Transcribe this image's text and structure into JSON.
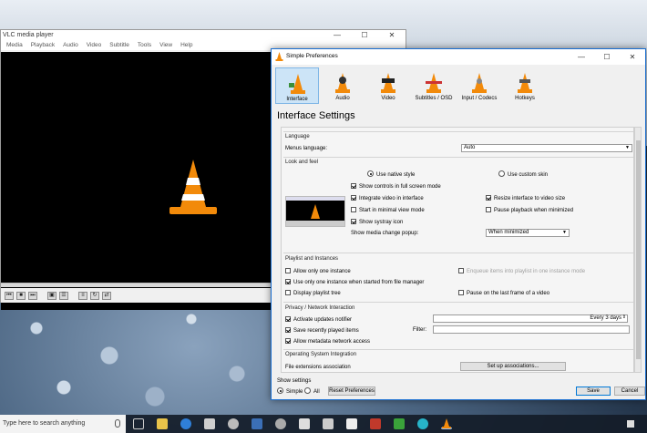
{
  "vlc": {
    "title": "VLC media player",
    "menu": [
      "Media",
      "Playback",
      "Audio",
      "Video",
      "Subtitle",
      "Tools",
      "View",
      "Help"
    ],
    "controls": [
      "previous-icon",
      "stop-icon",
      "next-icon",
      "fullscreen-icon",
      "extended-settings-icon",
      "playlist-icon",
      "loop-icon",
      "shuffle-icon"
    ]
  },
  "prefs": {
    "title": "Simple Preferences",
    "heading": "Interface Settings",
    "categories": [
      "Interface",
      "Audio",
      "Video",
      "Subtitles / OSD",
      "Input / Codecs",
      "Hotkeys"
    ],
    "language": {
      "title": "Language",
      "menus_label": "Menus language:",
      "menus_value": "Auto"
    },
    "look": {
      "title": "Look and feel",
      "native": "Use native style",
      "custom": "Use custom skin",
      "show_controls": "Show controls in full screen mode",
      "integrate": "Integrate video in interface",
      "minimal": "Start in minimal view mode",
      "systray": "Show systray icon",
      "resize": "Resize interface to video size",
      "pause_min": "Pause playback when minimized",
      "popup_label": "Show media change popup:",
      "popup_value": "When minimized"
    },
    "playlist": {
      "title": "Playlist and Instances",
      "one_instance": "Allow only one instance",
      "enqueue": "Enqueue items into playlist in one instance mode",
      "file_manager": "Use only one instance when started from file manager",
      "pause_last": "Pause on the last frame of a video",
      "display_tree": "Display playlist tree"
    },
    "privacy": {
      "title": "Privacy / Network Interaction",
      "updates": "Activate updates notifier",
      "updates_value": "Every 3 days",
      "recent": "Save recently played items",
      "filter_label": "Filter:",
      "metadata": "Allow metadata network access"
    },
    "os": {
      "title": "Operating System Integration",
      "file_ext": "File extensions association",
      "setup_btn": "Set up associations..."
    },
    "footer": {
      "show_settings": "Show settings",
      "simple": "Simple",
      "all": "All",
      "reset": "Reset Preferences",
      "save": "Save",
      "cancel": "Cancel"
    }
  },
  "taskbar": {
    "search": "Type here to search anything"
  },
  "colors": {
    "accent": "#0078d7",
    "cone_orange": "#f28a0a"
  }
}
